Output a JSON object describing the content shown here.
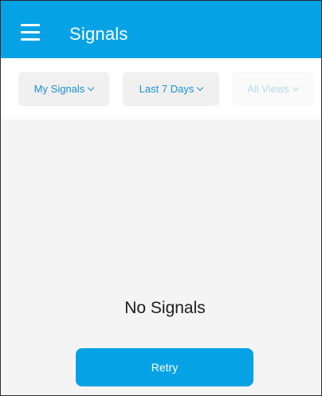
{
  "header": {
    "title": "Signals",
    "menu_icon": "hamburger-menu-icon",
    "background_color": "#05a3e5"
  },
  "filters": [
    {
      "label": "My Signals",
      "state": "enabled",
      "icon": "chevron-down-icon"
    },
    {
      "label": "Last 7 Days",
      "state": "enabled",
      "icon": "chevron-down-icon"
    },
    {
      "label": "All Views",
      "state": "disabled",
      "icon": "chevron-down-icon"
    }
  ],
  "empty_state": {
    "message": "No Signals",
    "button_label": "Retry",
    "button_color": "#05a3e5"
  }
}
